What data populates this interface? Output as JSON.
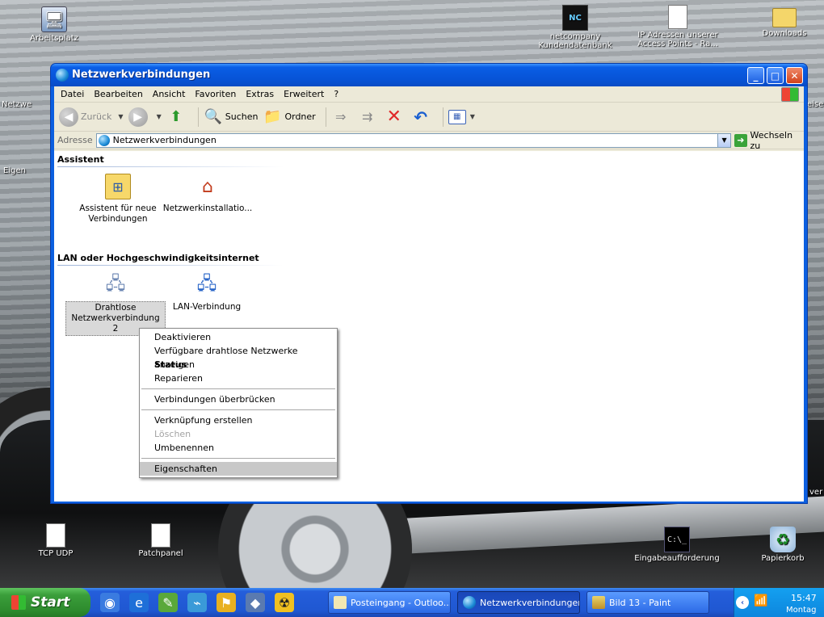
{
  "desktop": {
    "icons": {
      "arbeitsplatz": "Arbeitsplatz",
      "netcompany": "netcompany Kundendatenbank",
      "ip_adressen": "IP Adressen unserer Access Points - Ra...",
      "downloads": "Downloads",
      "tcp_udp": "TCP UDP",
      "patchpanel": "Patchpanel",
      "eingabe": "Eingabeaufforderung",
      "papierkorb": "Papierkorb",
      "nc_badge": "NC",
      "cmd_badge": "C:\\_"
    },
    "fragments": {
      "left1": "Netzwe",
      "left2": "Eigen",
      "right1": "eise",
      "right2": "ver"
    }
  },
  "window": {
    "title": "Netzwerkverbindungen",
    "menu": [
      "Datei",
      "Bearbeiten",
      "Ansicht",
      "Favoriten",
      "Extras",
      "Erweitert",
      "?"
    ],
    "toolbar": {
      "back": "Zurück",
      "search": "Suchen",
      "folders": "Ordner"
    },
    "address": {
      "label": "Adresse",
      "value": "Netzwerkverbindungen",
      "go": "Wechseln zu"
    },
    "groups": [
      {
        "header": "Assistent",
        "items": [
          "Assistent für neue Verbindungen",
          "Netzwerkinstallatio..."
        ]
      },
      {
        "header": "LAN oder Hochgeschwindigkeitsinternet",
        "items": [
          "Drahtlose Netzwerkverbindung 2",
          "LAN-Verbindung"
        ]
      }
    ]
  },
  "context_menu": {
    "deaktivieren": "Deaktivieren",
    "netzwerke": "Verfügbare drahtlose Netzwerke anzeigen",
    "status": "Status",
    "reparieren": "Reparieren",
    "ueberbruecken": "Verbindungen überbrücken",
    "verknuepfung": "Verknüpfung erstellen",
    "loeschen": "Löschen",
    "umbenennen": "Umbenennen",
    "eigenschaften": "Eigenschaften"
  },
  "taskbar": {
    "start": "Start",
    "tasks": [
      "Posteingang - Outloo...",
      "Netzwerkverbindungen",
      "Bild 13 - Paint"
    ],
    "clock": "15:47",
    "day": "Montag"
  }
}
